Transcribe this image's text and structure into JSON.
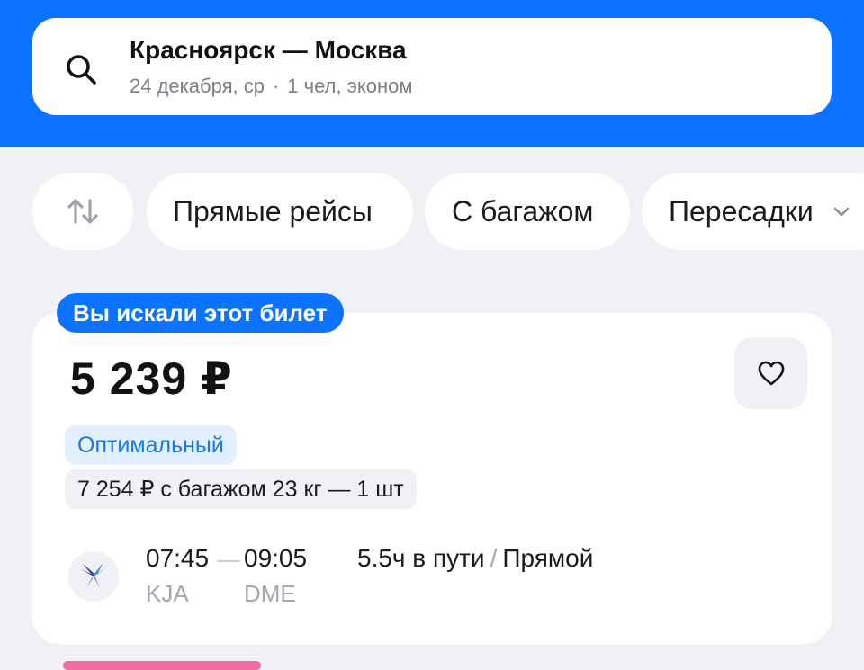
{
  "search": {
    "route": "Красноярск — Москва",
    "date": "24 декабря, ср",
    "passengers": "1 чел, эконом"
  },
  "filters": {
    "sort_icon": "sort-arrows-icon",
    "chips": [
      "Прямые рейсы",
      "С багажом",
      "Пересадки"
    ]
  },
  "ticket": {
    "badge": "Вы искали этот билет",
    "price": "5 239 ₽",
    "tag": "Оптимальный",
    "baggage_offer": "7 254 ₽ с багажом 23 кг — 1 шт",
    "departure_time": "07:45",
    "arrival_time": "09:05",
    "departure_code": "KJA",
    "arrival_code": "DME",
    "duration": "5.5ч в пути",
    "separator": "/",
    "flight_type": "Прямой",
    "airline_icon": "bird-logo-icon",
    "favorite_icon": "heart-icon"
  },
  "colors": {
    "brand_blue": "#0c73fe",
    "background": "#eff1f5",
    "tag_blue_text": "#1c77e6",
    "tag_blue_bg": "#e3f0ff"
  }
}
